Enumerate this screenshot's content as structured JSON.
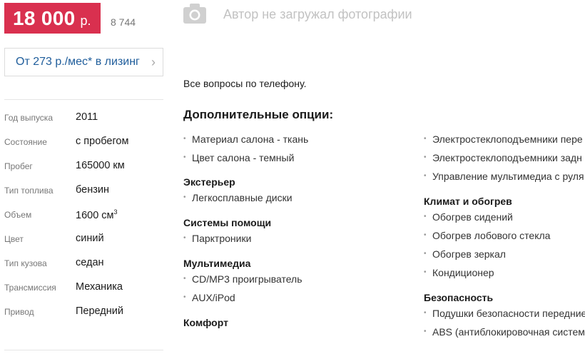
{
  "price": {
    "amount": "18 000",
    "currency": "р.",
    "alt": "8 744"
  },
  "leasing": {
    "label": "От 273 р./мес* в лизинг",
    "chevron": "chevron-right-icon"
  },
  "specs": [
    {
      "key": "Год выпуска",
      "value": "2011"
    },
    {
      "key": "Состояние",
      "value": "с пробегом"
    },
    {
      "key": "Пробег",
      "value": "165000 км"
    },
    {
      "key": "Тип топлива",
      "value": "бензин"
    },
    {
      "key": "Объем",
      "value": "1600 см",
      "sup": "3"
    },
    {
      "key": "Цвет",
      "value": "синий"
    },
    {
      "key": "Тип кузова",
      "value": "седан"
    },
    {
      "key": "Трансмиссия",
      "value": "Механика"
    },
    {
      "key": "Привод",
      "value": "Передний"
    }
  ],
  "photo": {
    "icon": "camera-icon",
    "text": "Автор не загружал фотографии"
  },
  "description": "Все вопросы по телефону.",
  "options": {
    "title": "Дополнительные опции:",
    "left": {
      "general": [
        "Материал салона - ткань",
        "Цвет салона - темный"
      ],
      "exterior": {
        "title": "Экстерьер",
        "items": [
          "Легкосплавные диски"
        ]
      },
      "assist": {
        "title": "Системы помощи",
        "items": [
          "Парктроники"
        ]
      },
      "multimedia": {
        "title": "Мультимедиа",
        "items": [
          "CD/MP3 проигрыватель",
          "AUX/iPod"
        ]
      },
      "comfort": {
        "title": "Комфорт"
      }
    },
    "right": {
      "general": [
        "Электростеклоподъемники пере",
        "Электростеклоподъемники задн",
        "Управление мультимедиа с руля"
      ],
      "climate": {
        "title": "Климат и обогрев",
        "items": [
          "Обогрев сидений",
          "Обогрев лобового стекла",
          "Обогрев зеркал",
          "Кондиционер"
        ]
      },
      "safety": {
        "title": "Безопасность",
        "items": [
          "Подушки безопасности передние",
          "ABS (антиблокировочная систем"
        ]
      }
    }
  },
  "colors": {
    "price_bg": "#d9304f",
    "link": "#1f5d9b",
    "muted": "#777777"
  }
}
